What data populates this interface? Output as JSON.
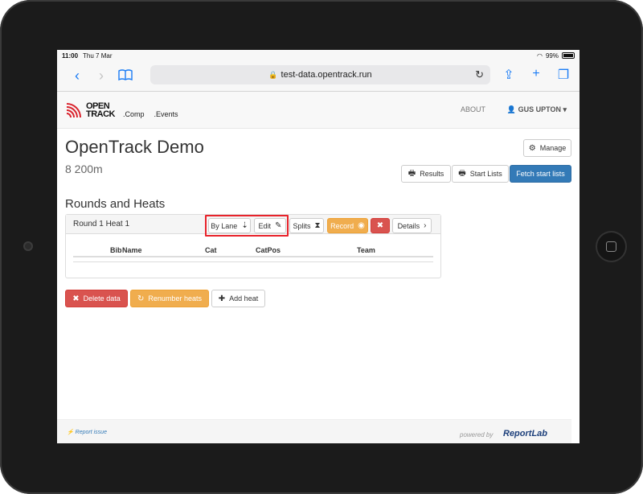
{
  "status": {
    "time": "11:00",
    "date": "Thu 7 Mar",
    "battery": "99%"
  },
  "browser": {
    "url": "test-data.opentrack.run"
  },
  "nav": {
    "logo_line1": "OPEN",
    "logo_line2": "TRACK",
    "links": [
      ".Comp",
      ".Events"
    ],
    "about": "ABOUT",
    "user": "GUS UPTON"
  },
  "page": {
    "title": "OpenTrack Demo",
    "subtitle": "8 200m",
    "manage": "Manage",
    "results": "Results",
    "start_lists": "Start Lists",
    "fetch_start_lists": "Fetch start lists"
  },
  "rounds": {
    "heading": "Rounds and Heats",
    "heat_title": "Round 1 Heat 1",
    "by_lane": "By Lane",
    "edit": "Edit",
    "splits": "Splits",
    "record": "Record",
    "details": "Details",
    "columns": [
      "Bib",
      "Name",
      "Cat",
      "CatPos",
      "Team"
    ]
  },
  "actions": {
    "delete": "Delete data",
    "renumber": "Renumber heats",
    "add_heat": "Add heat"
  },
  "footer": {
    "report": "Report issue",
    "powered": "powered by",
    "brand": "ReportLab"
  },
  "colors": {
    "primary": "#337ab7",
    "danger": "#d9534f",
    "warning": "#f0ad4e",
    "highlight": "#e8232b"
  }
}
